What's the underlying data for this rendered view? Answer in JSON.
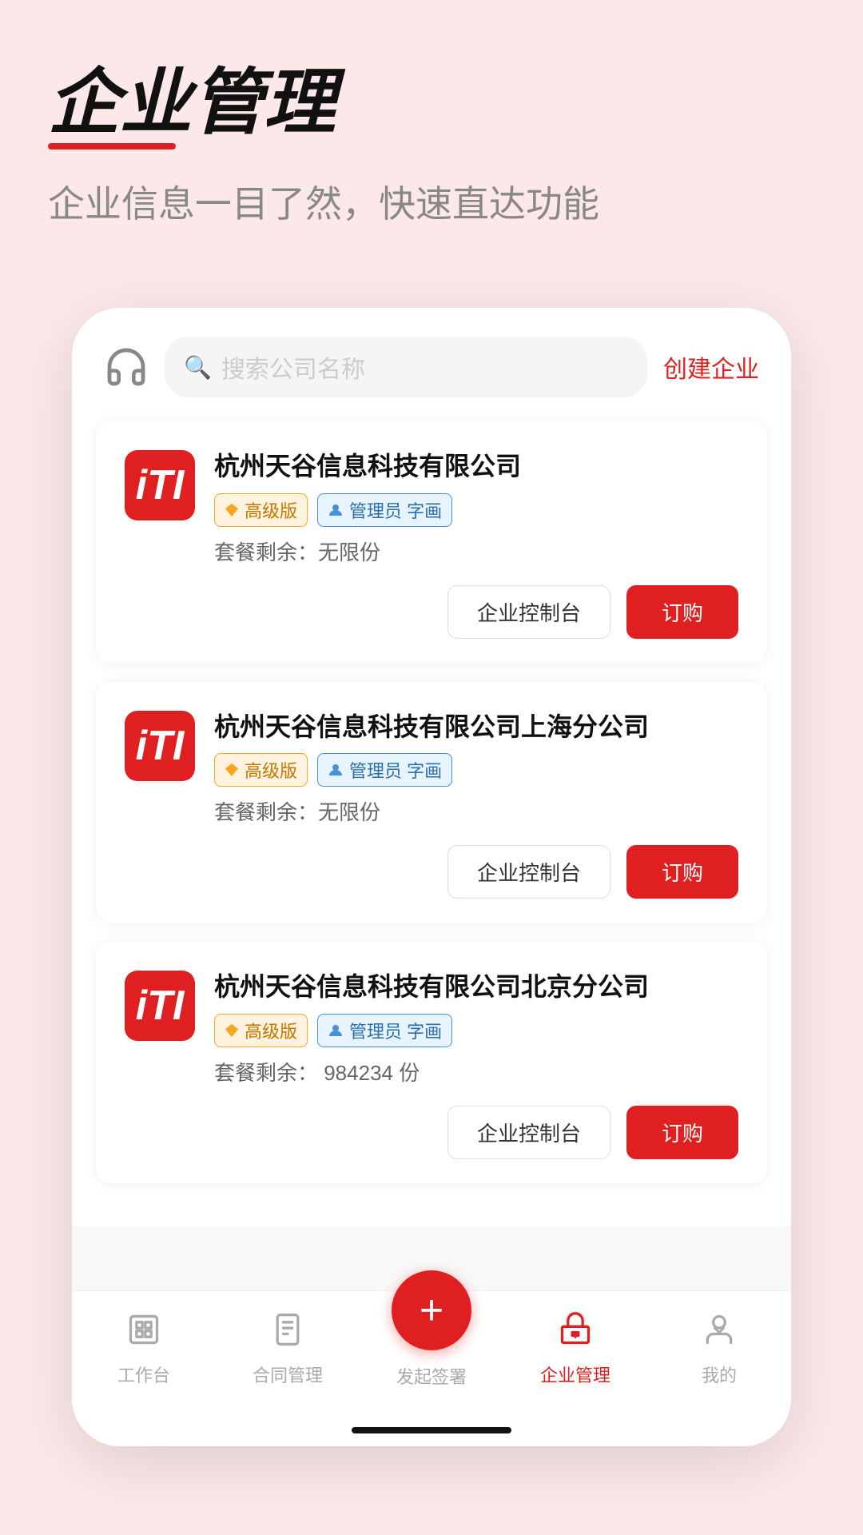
{
  "page": {
    "title": "企业管理",
    "subtitle": "企业信息一目了然，快速直达功能",
    "background_color": "#fce8e8"
  },
  "search_bar": {
    "placeholder": "搜索公司名称",
    "create_label": "创建企业"
  },
  "companies": [
    {
      "id": 1,
      "name": "杭州天谷信息科技有限公司",
      "plan": "高级版",
      "role": "管理员 字画",
      "quota_label": "套餐剩余：",
      "quota_value": "无限份",
      "logo_text": "iTI"
    },
    {
      "id": 2,
      "name": "杭州天谷信息科技有限公司上海分公司",
      "plan": "高级版",
      "role": "管理员 字画",
      "quota_label": "套餐剩余：",
      "quota_value": "无限份",
      "logo_text": "iTI"
    },
    {
      "id": 3,
      "name": "杭州天谷信息科技有限公司北京分公司",
      "plan": "高级版",
      "role": "管理员 字画",
      "quota_label": "套餐剩余：",
      "quota_value": "984234 份",
      "logo_text": "iTI"
    }
  ],
  "actions": {
    "control_label": "企业控制台",
    "order_label": "订购"
  },
  "bottom_nav": {
    "items": [
      {
        "label": "工作台",
        "icon": "workbench",
        "active": false
      },
      {
        "label": "合同管理",
        "icon": "contract",
        "active": false
      },
      {
        "label": "发起签署",
        "icon": "add",
        "active": false,
        "fab": true
      },
      {
        "label": "企业管理",
        "icon": "enterprise",
        "active": true
      },
      {
        "label": "我的",
        "icon": "profile",
        "active": false
      }
    ]
  }
}
